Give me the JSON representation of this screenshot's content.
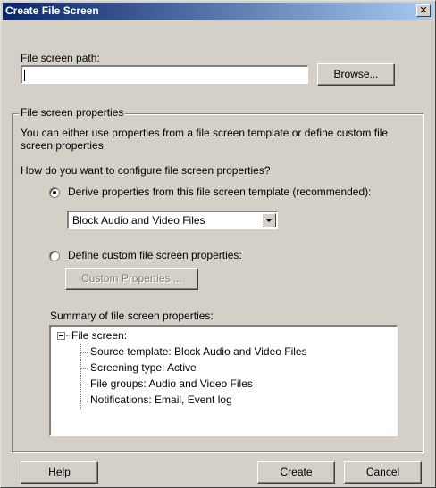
{
  "window": {
    "title": "Create File Screen",
    "close_glyph": "✕"
  },
  "path": {
    "label": "File screen path:",
    "value": "",
    "browse_label": "Browse..."
  },
  "properties": {
    "group_title": "File screen properties",
    "intro": "You can either use properties from a file screen template or define custom file screen properties.",
    "question": "How do you want to configure file screen properties?",
    "option_template": {
      "label": "Derive properties from this file screen template (recommended):",
      "selected": true
    },
    "template_select": {
      "value": "Block Audio and Video Files"
    },
    "option_custom": {
      "label": "Define custom file screen properties:",
      "selected": false
    },
    "custom_button": "Custom Properties ...",
    "summary_label": "Summary of file screen properties:",
    "summary": {
      "root": "File screen:",
      "items": [
        "Source template: Block Audio and Video Files",
        "Screening type: Active",
        "File groups: Audio and Video Files",
        "Notifications: Email, Event log"
      ]
    }
  },
  "footer": {
    "help": "Help",
    "create": "Create",
    "cancel": "Cancel"
  },
  "icons": {
    "close": "close-icon",
    "dropdown": "chevron-down-icon",
    "tree_expander": "collapse-icon"
  },
  "colors": {
    "dialog_bg": "#d4d0c8",
    "titlebar_start": "#0a246a",
    "titlebar_end": "#a6caf0"
  }
}
